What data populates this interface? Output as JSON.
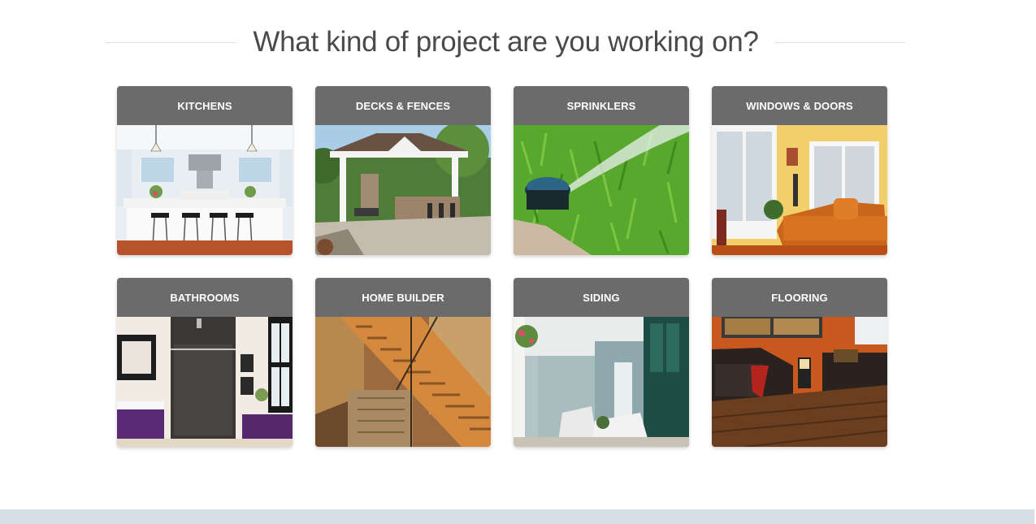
{
  "section": {
    "title": "What kind of project are you working on?"
  },
  "projects": [
    {
      "label": "KITCHENS",
      "image": "kitchen-photo"
    },
    {
      "label": "DECKS & FENCES",
      "image": "deck-photo"
    },
    {
      "label": "SPRINKLERS",
      "image": "sprinkler-photo"
    },
    {
      "label": "WINDOWS & DOORS",
      "image": "windows-photo"
    },
    {
      "label": "BATHROOMS",
      "image": "bathroom-photo"
    },
    {
      "label": "HOME BUILDER",
      "image": "stairs-photo"
    },
    {
      "label": "SIDING",
      "image": "siding-photo"
    },
    {
      "label": "FLOORING",
      "image": "flooring-photo"
    }
  ],
  "colors": {
    "card_header": "#6b6b6b",
    "footer_band": "#d5dee6",
    "heading_text": "#4a4a4a"
  }
}
